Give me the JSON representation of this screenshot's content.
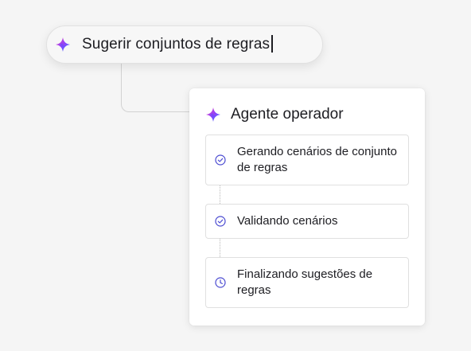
{
  "prompt": {
    "text": "Sugerir conjuntos de regras",
    "icon": "gradient-sparkle-logo-icon"
  },
  "card": {
    "title": "Agente operador",
    "icon": "gradient-sparkle-logo-icon",
    "steps": [
      {
        "label": "Gerando cenários de conjunto de regras",
        "status": "done",
        "icon": "check-circle-icon"
      },
      {
        "label": "Validando cenários",
        "status": "done",
        "icon": "check-circle-icon"
      },
      {
        "label": "Finalizando sugestões de regras",
        "status": "pending",
        "icon": "clock-icon"
      }
    ]
  },
  "colors": {
    "accent": "#4b4bd1",
    "logo_gradient": [
      "#ff3fa4",
      "#8b3dff",
      "#2f7bff"
    ],
    "background": "#f5f5f5",
    "card": "#ffffff"
  }
}
